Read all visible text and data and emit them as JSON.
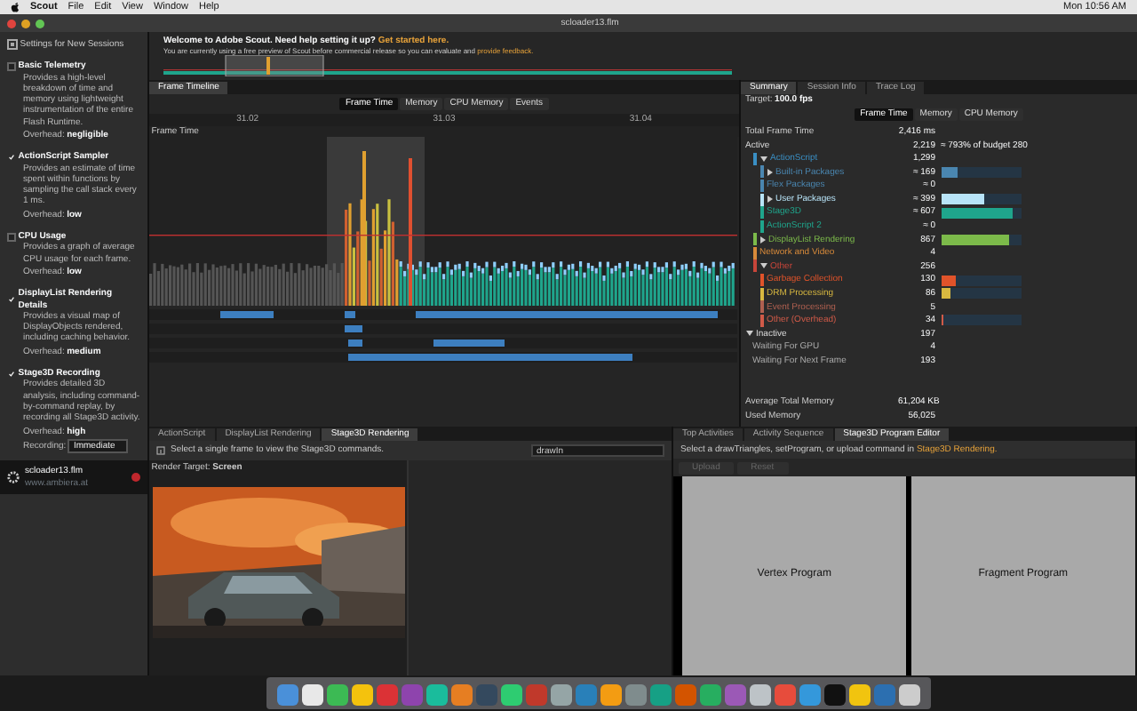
{
  "menubar": {
    "items": [
      "Scout",
      "File",
      "Edit",
      "View",
      "Window",
      "Help"
    ],
    "clock": "Mon 10:56 AM"
  },
  "window": {
    "title": "scloader13.flm"
  },
  "settings": {
    "title": "Settings for New Sessions",
    "options": [
      {
        "name": "Basic Telemetry",
        "checked": false,
        "description": "Provides a high-level breakdown of time and memory using lightweight instrumentation of the entire Flash Runtime.",
        "overhead_label": "Overhead:",
        "overhead": "negligible"
      },
      {
        "name": "ActionScript Sampler",
        "checked": true,
        "description": "Provides an estimate of time spent within functions by sampling the call stack every 1 ms.",
        "overhead_label": "Overhead:",
        "overhead": "low"
      },
      {
        "name": "CPU Usage",
        "checked": false,
        "description": "Provides a graph of average CPU usage for each frame.",
        "overhead_label": "Overhead:",
        "overhead": "low"
      },
      {
        "name": "DisplayList Rendering Details",
        "checked": true,
        "description": "Provides a visual map of DisplayObjects rendered, including caching behavior.",
        "overhead_label": "Overhead:",
        "overhead": "medium"
      },
      {
        "name": "Stage3D Recording",
        "checked": true,
        "description": "Provides detailed 3D analysis, including command-by-command replay, by recording all Stage3D activity.",
        "overhead_label": "Overhead:",
        "overhead": "high"
      }
    ],
    "recording": {
      "label": "Recording:",
      "value": "Immediate"
    }
  },
  "session": {
    "file": "scloader13.flm",
    "url": "www.ambiera.at"
  },
  "welcome": {
    "line1": "Welcome to Adobe Scout. Need help setting it up?",
    "link1": "Get started here.",
    "line2": "You are currently using a free preview of Scout before commercial release so you can evaluate and",
    "link2": "provide feedback."
  },
  "timeline": {
    "tab": "Frame Timeline",
    "modes": [
      {
        "label": "Frame Time",
        "selected": true
      },
      {
        "label": "Memory",
        "selected": false
      },
      {
        "label": "CPU Memory",
        "selected": false
      },
      {
        "label": "Events",
        "selected": false
      }
    ],
    "ticks": [
      "31.02",
      "31.03",
      "31.04"
    ],
    "chart_label": "Frame Time"
  },
  "summary": {
    "tabs": [
      {
        "label": "Summary",
        "selected": true
      },
      {
        "label": "Session Info",
        "selected": false
      },
      {
        "label": "Trace Log",
        "selected": false
      }
    ],
    "target_label": "Target:",
    "target": "100.0 fps",
    "modes": [
      {
        "label": "Frame Time",
        "selected": true
      },
      {
        "label": "Memory",
        "selected": false
      },
      {
        "label": "CPU Memory",
        "selected": false
      }
    ],
    "total": {
      "label": "Total Frame Time",
      "value": "2,416 ms"
    },
    "rows": [
      {
        "label": "Active",
        "value": "2,219",
        "note": "≈ 793% of budget 280",
        "children": [
          {
            "label": "ActionScript",
            "value": "1,299",
            "color": "#3a8fc4",
            "expanded": true,
            "children": [
              {
                "label": "Built-in Packages",
                "value": "≈ 169",
                "color": "#4a86b0",
                "level": 0.22,
                "expanded": false
              },
              {
                "label": "Flex Packages",
                "value": "≈ 0",
                "color": "#4a86b0"
              },
              {
                "label": "User Packages",
                "value": "≈ 399",
                "color": "#b8e4f8",
                "level": 0.55,
                "expanded": false
              },
              {
                "label": "Stage3D",
                "value": "≈ 607",
                "color": "#1fa58c",
                "level": 0.9
              },
              {
                "label": "ActionScript 2",
                "value": "≈ 0",
                "color": "#1fa58c"
              }
            ]
          },
          {
            "label": "DisplayList Rendering",
            "value": "867",
            "color": "#7cba4a",
            "level": 0.85,
            "expanded": false
          },
          {
            "label": "Network and Video",
            "value": "4",
            "color": "#d88a3a"
          },
          {
            "label": "Other",
            "value": "256",
            "color": "#c8453a",
            "expanded": true,
            "children": [
              {
                "label": "Garbage Collection",
                "value": "130",
                "color": "#e0532a",
                "level": 0.18
              },
              {
                "label": "DRM Processing",
                "value": "86",
                "color": "#d8b840",
                "level": 0.12
              },
              {
                "label": "Event Processing",
                "value": "5",
                "color": "#b06050"
              },
              {
                "label": "Other (Overhead)",
                "value": "34",
                "color": "#d05a48",
                "level": 0.04
              }
            ]
          }
        ]
      },
      {
        "label": "Inactive",
        "value": "197",
        "expanded": true,
        "children": [
          {
            "label": "Waiting For GPU",
            "value": "4"
          },
          {
            "label": "Waiting For Next Frame",
            "value": "193"
          }
        ]
      }
    ],
    "memory": [
      {
        "label": "Average Total Memory",
        "value": "61,204 KB"
      },
      {
        "label": "Used Memory",
        "value": "56,025"
      }
    ]
  },
  "stage3d_pane": {
    "tabs": [
      {
        "label": "ActionScript",
        "selected": false
      },
      {
        "label": "DisplayList Rendering",
        "selected": false
      },
      {
        "label": "Stage3D Rendering",
        "selected": true
      }
    ],
    "hint": "Select a single frame to view the Stage3D commands.",
    "filter": "drawIn",
    "render_target": "Render Target: **Screen**"
  },
  "program_pane": {
    "tabs": [
      {
        "label": "Top Activities",
        "selected": false
      },
      {
        "label": "Activity Sequence",
        "selected": false
      },
      {
        "label": "Stage3D Program Editor",
        "selected": true
      }
    ],
    "hint": "Select a drawTriangles, setProgram, or upload command in",
    "link": "Stage3D Rendering.",
    "buttons": [
      {
        "label": "Upload",
        "disabled": true
      },
      {
        "label": "Reset",
        "disabled": true
      }
    ],
    "panels": [
      "Vertex Program",
      "Fragment Program"
    ]
  }
}
